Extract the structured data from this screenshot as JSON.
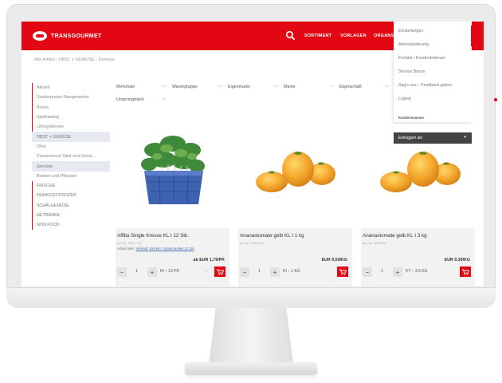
{
  "brand": {
    "name": "TRANSGOURMET",
    "accent": "#e30613"
  },
  "nav": {
    "items": [
      "SORTIMENT",
      "VORLAGEN",
      "ORGANS"
    ]
  },
  "breadcrumb": {
    "text": "Alle Artikel  ›  OBST + GEMÜSE  ›  Gemüse"
  },
  "sidebar": {
    "items": [
      "Aktuell",
      "Sonderpreise-Stangeneishe",
      "Bonus",
      "Spotkatalog",
      "Lifestyleboxen",
      "OBST + GEMÜSE",
      "Obst",
      "Convenience Obst und Gemü...",
      "Gemüse",
      "Blumen und Pflanzen",
      "FRISCHE",
      "FEINKOST/FROZEN",
      "SCHÄLGEMÜSE",
      "GETRÄNKE",
      "NON FOOD"
    ],
    "selected": "Gemüse"
  },
  "filters": [
    "Merkmale",
    "Warengruppe",
    "Eigenmarke",
    "Marke",
    "Eigenschaft",
    "Ursprungsland"
  ],
  "products": [
    {
      "title": "Affilla Single Kresse KL I 12 Stk.",
      "art": "Art.-Nr. 2603 / 00",
      "note_prefix": "Artikel aller: ",
      "note_link": "Verkauf: Einzeln / Stammartikel 12 Stk",
      "price": "ab EUR 1,79/PK",
      "qty": "1",
      "unit": "KI – 12 PK"
    },
    {
      "title": "Ananastomate gelb KL I 1 kg",
      "art": "Art.-Nr. 2084443",
      "note_prefix": "",
      "note_link": "",
      "price": "EUR 9,59/KG",
      "qty": "1",
      "unit": "KI – 1 KG"
    },
    {
      "title": "Ananastomate gelb KL I 3 kg",
      "art": "Art.-Nr. 2084443",
      "note_prefix": "",
      "note_link": "",
      "price": "EUR 9,39/KG",
      "qty": "1",
      "unit": "KT – 3,5 KG"
    }
  ],
  "account_menu": {
    "items": [
      "Einstellungen",
      "Adressänderung",
      "Kontakt / Kundenbetreuer",
      "Service Bonus",
      "Sag's uns – Feedback geben",
      "Logout"
    ],
    "section": "Kundennummer",
    "select_label": "Einloggen als"
  },
  "icons": {
    "search": "search-icon",
    "cart": "cart-icon",
    "plus": "plus-icon",
    "minus": "minus-icon",
    "chevron": "chevron-down-icon"
  }
}
